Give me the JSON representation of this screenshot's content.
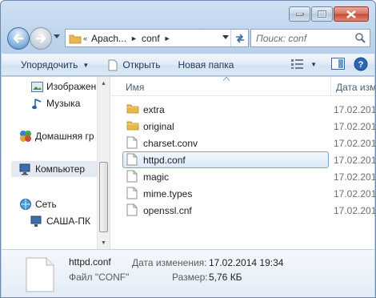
{
  "address": {
    "crumbs": [
      "Apach...",
      "conf"
    ],
    "overflow_marker": "«"
  },
  "search": {
    "placeholder": "Поиск: conf"
  },
  "toolbar": {
    "organize_label": "Упорядочить",
    "open_label": "Открыть",
    "new_folder_label": "Новая папка"
  },
  "nav_pane": {
    "items": [
      {
        "label": "Изображен",
        "icon": "pictures-icon"
      },
      {
        "label": "Музыка",
        "icon": "music-icon"
      },
      {
        "label": "Домашняя гр",
        "icon": "homegroup-icon"
      },
      {
        "label": "Компьютер",
        "icon": "computer-icon"
      },
      {
        "label": "Сеть",
        "icon": "network-icon"
      },
      {
        "label": "САША-ПК",
        "icon": "network-pc-icon"
      }
    ]
  },
  "columns": {
    "name": "Имя",
    "date": "Дата изм"
  },
  "files": [
    {
      "name": "extra",
      "type": "folder",
      "date": "17.02.201"
    },
    {
      "name": "original",
      "type": "folder",
      "date": "17.02.201"
    },
    {
      "name": "charset.conv",
      "type": "file",
      "date": "17.02.201"
    },
    {
      "name": "httpd.conf",
      "type": "file",
      "date": "17.02.201",
      "selected": true
    },
    {
      "name": "magic",
      "type": "file",
      "date": "17.02.201"
    },
    {
      "name": "mime.types",
      "type": "file",
      "date": "17.02.201"
    },
    {
      "name": "openssl.cnf",
      "type": "file",
      "date": "17.02.201"
    }
  ],
  "details": {
    "name": "httpd.conf",
    "type": "Файл \"CONF\"",
    "modified_label": "Дата изменения:",
    "modified_value": "17.02.2014 19:34",
    "size_label": "Размер:",
    "size_value": "5,76 КБ"
  },
  "colors": {
    "folder": "#e8b84a",
    "selection_border": "#7da2ce",
    "link_text": "#1e395b"
  }
}
